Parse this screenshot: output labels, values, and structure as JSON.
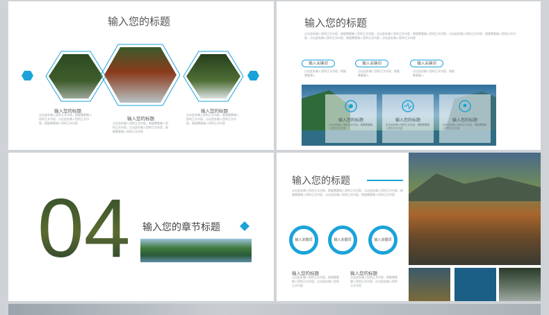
{
  "slide1": {
    "title": "输入您的标题",
    "captions": [
      {
        "label": "输入您的标题",
        "text": "点击此处输入您的正文内容，根据需要输入您的正文内容，点击此处输入您的正文内容，根据需要输入您的正文内容"
      },
      {
        "label": "输入您的标题",
        "text": "点击此处输入您的正文内容，根据需要输入您的正文内容，点击此处输入您的正文内容，根据需要输入您的正文内容"
      },
      {
        "label": "输入您的标题",
        "text": "点击此处输入您的正文内容，根据需要输入您的正文内容，点击此处输入您的正文内容，根据需要输入您的正文内容"
      }
    ]
  },
  "slide2": {
    "title": "输入您的标题",
    "paragraph": "点击此处输入您的正文内容，根据需要输入您的正文内容，点击此处输入您的正文内容，根据需要输入您的正文内容，点击此处输入您的正文内容，根据需要输入您的正文内容，点击此处输入您的正文内容，根据需要输入您的正文内容，点击此处输入您的正文内容",
    "keywords": [
      {
        "label": "输入关键词",
        "text": "点击此处输入您的正文内容，根据需要输入"
      },
      {
        "label": "输入关键词",
        "text": "点击此处输入您的正文内容，根据需要输入"
      },
      {
        "label": "输入关键词",
        "text": "点击此处输入您的正文内容，根据需要输入"
      }
    ],
    "panels": [
      {
        "label": "输入您的标题",
        "text": "点击此处输入您的正文内容，根据需要输入您的正文内容"
      },
      {
        "label": "输入您的标题",
        "text": "点击此处输入您的正文内容，根据需要输入您的正文内容"
      },
      {
        "label": "输入您的标题",
        "text": "点击此处输入您的正文内容，根据需要输入您的正文内容"
      }
    ]
  },
  "slide3": {
    "number": "04",
    "chapter_title": "输入您的章节标题"
  },
  "slide4": {
    "title": "输入您的标题",
    "paragraph": "点击此处输入您的正文内容，根据需要输入您的正文内容，点击此处输入您的正文内容，根据需要输入您的正文内容，点击此处输入您的正文内容，根据需要输入您的正文内容",
    "rings": [
      "输入关键词",
      "输入关键词",
      "输入关键词"
    ],
    "subs": [
      {
        "label": "输入您的标题",
        "text": "点击此处输入您的正文内容，根据需要输入您的正文内容，点击此处输入您的正文内容"
      },
      {
        "label": "输入您的标题",
        "text": "点击此处输入您的正文内容，根据需要输入您的正文内容，点击此处输入您的正文内容"
      }
    ]
  },
  "colors": {
    "accent": "#1aa3d9",
    "dark_teal": "#1c5f86"
  }
}
